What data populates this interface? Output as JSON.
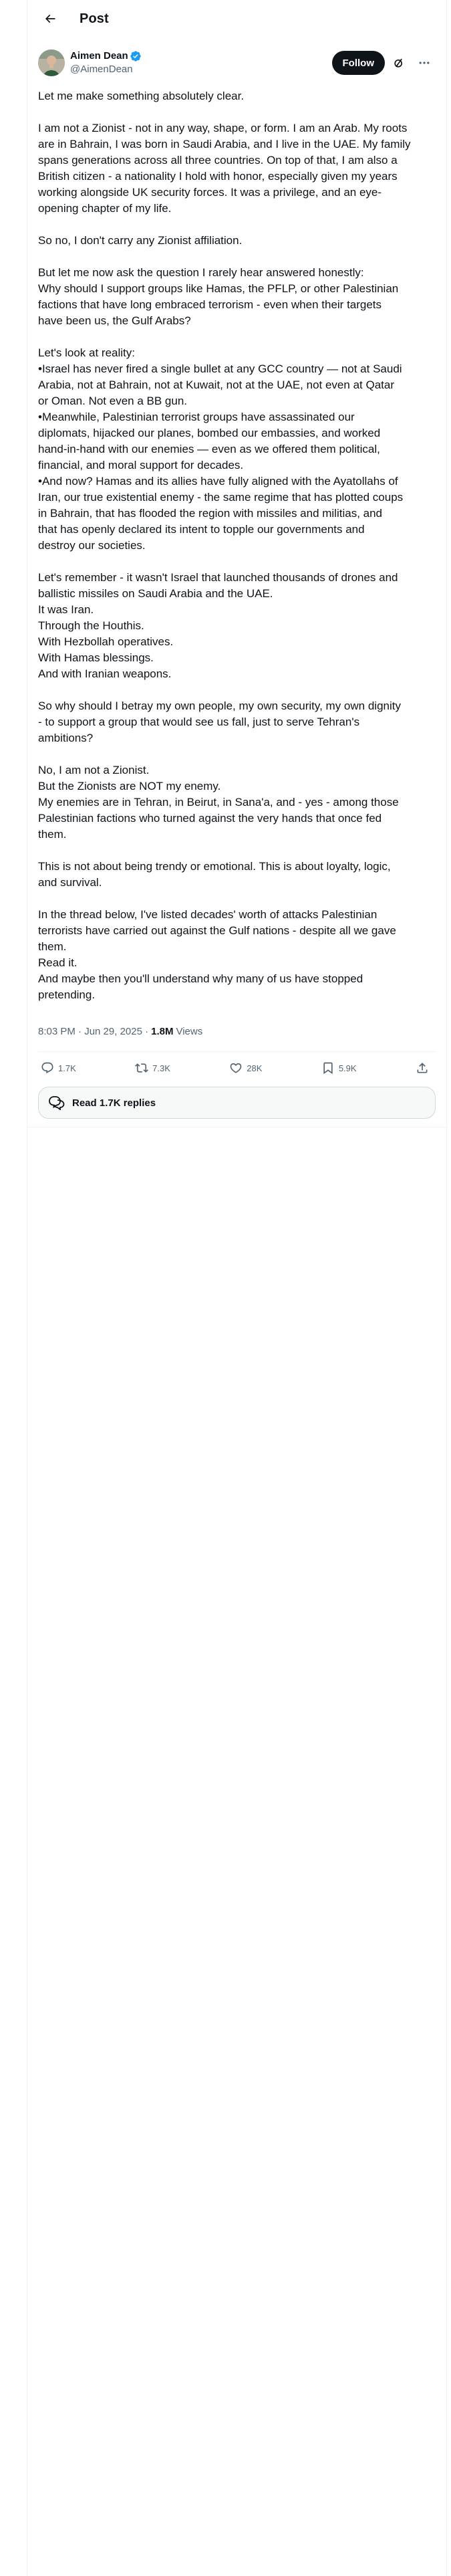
{
  "header": {
    "title": "Post"
  },
  "author": {
    "display_name": "Aimen Dean",
    "handle": "@AimenDean",
    "verified_icon": "verified-badge-icon"
  },
  "actions_top": {
    "follow_label": "Follow"
  },
  "post": {
    "paragraphs": [
      [
        "Let me make something absolutely clear."
      ],
      [
        "I am not a Zionist - not in any way, shape, or form. I am an Arab. My roots",
        "are in Bahrain, I was born in Saudi Arabia, and I live in the UAE. My family",
        "spans generations across all three countries. On top of that, I am also a",
        "British citizen - a nationality I hold with honor, especially given my years",
        "working alongside UK security forces. It was a privilege, and an eye-",
        "opening chapter of my life."
      ],
      [
        "So no, I don't carry any Zionist affiliation."
      ],
      [
        "But let me now ask the question I rarely hear answered honestly:",
        "Why should I support groups like Hamas, the PFLP, or other Palestinian",
        "factions that have long embraced terrorism - even when their targets",
        "have been us, the Gulf Arabs?"
      ],
      [
        "Let's look at reality:",
        "•Israel has never fired a single bullet at any GCC country — not at Saudi",
        "Arabia, not at Bahrain, not at Kuwait, not at the UAE, not even at Qatar",
        "or Oman. Not even a BB gun.",
        "•Meanwhile, Palestinian terrorist groups have assassinated our",
        "diplomats, hijacked our planes, bombed our embassies, and worked",
        "hand-in-hand with our enemies — even as we offered them political,",
        "financial, and moral support for decades.",
        "•And now? Hamas and its allies have fully aligned with the Ayatollahs of",
        "Iran, our true existential enemy - the same regime that has plotted coups",
        "in Bahrain, that has flooded the region with missiles and militias, and",
        "that has openly declared its intent to topple our governments and",
        "destroy our societies."
      ],
      [
        "Let's remember - it wasn't Israel that launched thousands of drones and",
        "ballistic missiles on Saudi Arabia and the UAE.",
        "It was Iran.",
        "Through the Houthis.",
        "With Hezbollah operatives.",
        "With Hamas blessings.",
        "And with Iranian weapons."
      ],
      [
        "So why should I betray my own people, my own security, my own dignity",
        "- to support a group that would see us fall, just to serve Tehran's",
        "ambitions?"
      ],
      [
        "No, I am not a Zionist.",
        "But the Zionists are NOT my enemy.",
        "My enemies are in Tehran, in Beirut, in Sana'a, and - yes - among those",
        "Palestinian factions who turned against the very hands that once fed",
        "them."
      ],
      [
        "This is not about being trendy or emotional. This is about loyalty, logic,",
        "and survival."
      ],
      [
        "In the thread below, I've listed decades' worth of attacks Palestinian",
        "terrorists have carried out against the Gulf nations - despite all we gave",
        "them.",
        "Read it.",
        "And maybe then you'll understand why many of us have stopped",
        "pretending."
      ]
    ],
    "timestamp": "8:03 PM · Jun 29, 2025 ·",
    "views_count": "1.8M",
    "views_label": "Views"
  },
  "engagement": {
    "replies": "1.7K",
    "reposts": "7.3K",
    "likes": "28K",
    "bookmarks": "5.9K"
  },
  "read_replies_label": "Read 1.7K replies"
}
